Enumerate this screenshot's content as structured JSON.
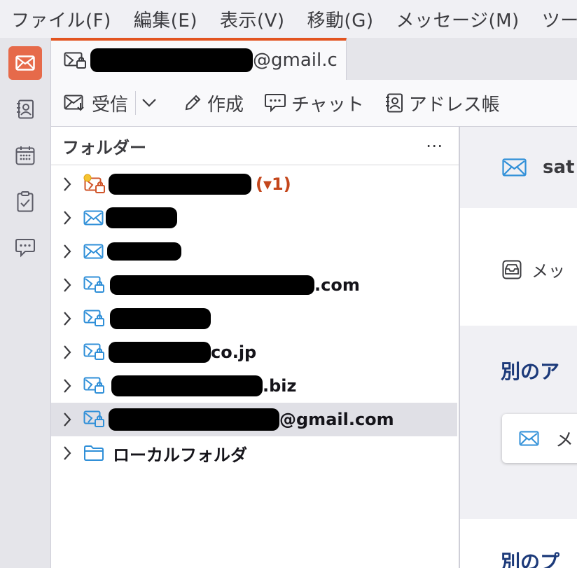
{
  "menu": [
    "ファイル(F)",
    "編集(E)",
    "表示(V)",
    "移動(G)",
    "メッセージ(M)",
    "ツー"
  ],
  "tab": {
    "title_suffix": "@gmail.c"
  },
  "toolbar": {
    "get_messages": "受信",
    "compose": "作成",
    "chat": "チャット",
    "address_book": "アドレス帳"
  },
  "folder_pane": {
    "title": "フォルダー",
    "more": "⋯",
    "accounts": [
      {
        "suffix": "",
        "unread": "(▾1)"
      },
      {
        "suffix": "",
        "unread": ""
      },
      {
        "suffix": "",
        "unread": ""
      },
      {
        "suffix": ".com",
        "unread": ""
      },
      {
        "suffix": "",
        "unread": ""
      },
      {
        "suffix": "co.jp",
        "unread": ""
      },
      {
        "suffix": ".biz",
        "unread": ""
      },
      {
        "suffix": "@gmail.com",
        "unread": ""
      }
    ],
    "local_folders": "ローカルフォルダ"
  },
  "content": {
    "account_name": "sat",
    "read_messages": "メッ",
    "other_account_heading": "別のア",
    "email_card": "メ",
    "other_product_heading": "別のプ"
  },
  "colors": {
    "accent": "#e25420",
    "active_space": "#e66a4a",
    "icon_blue": "#2f8fd8",
    "heading_blue": "#1c3a7a",
    "unread_orange": "#c4461b"
  }
}
